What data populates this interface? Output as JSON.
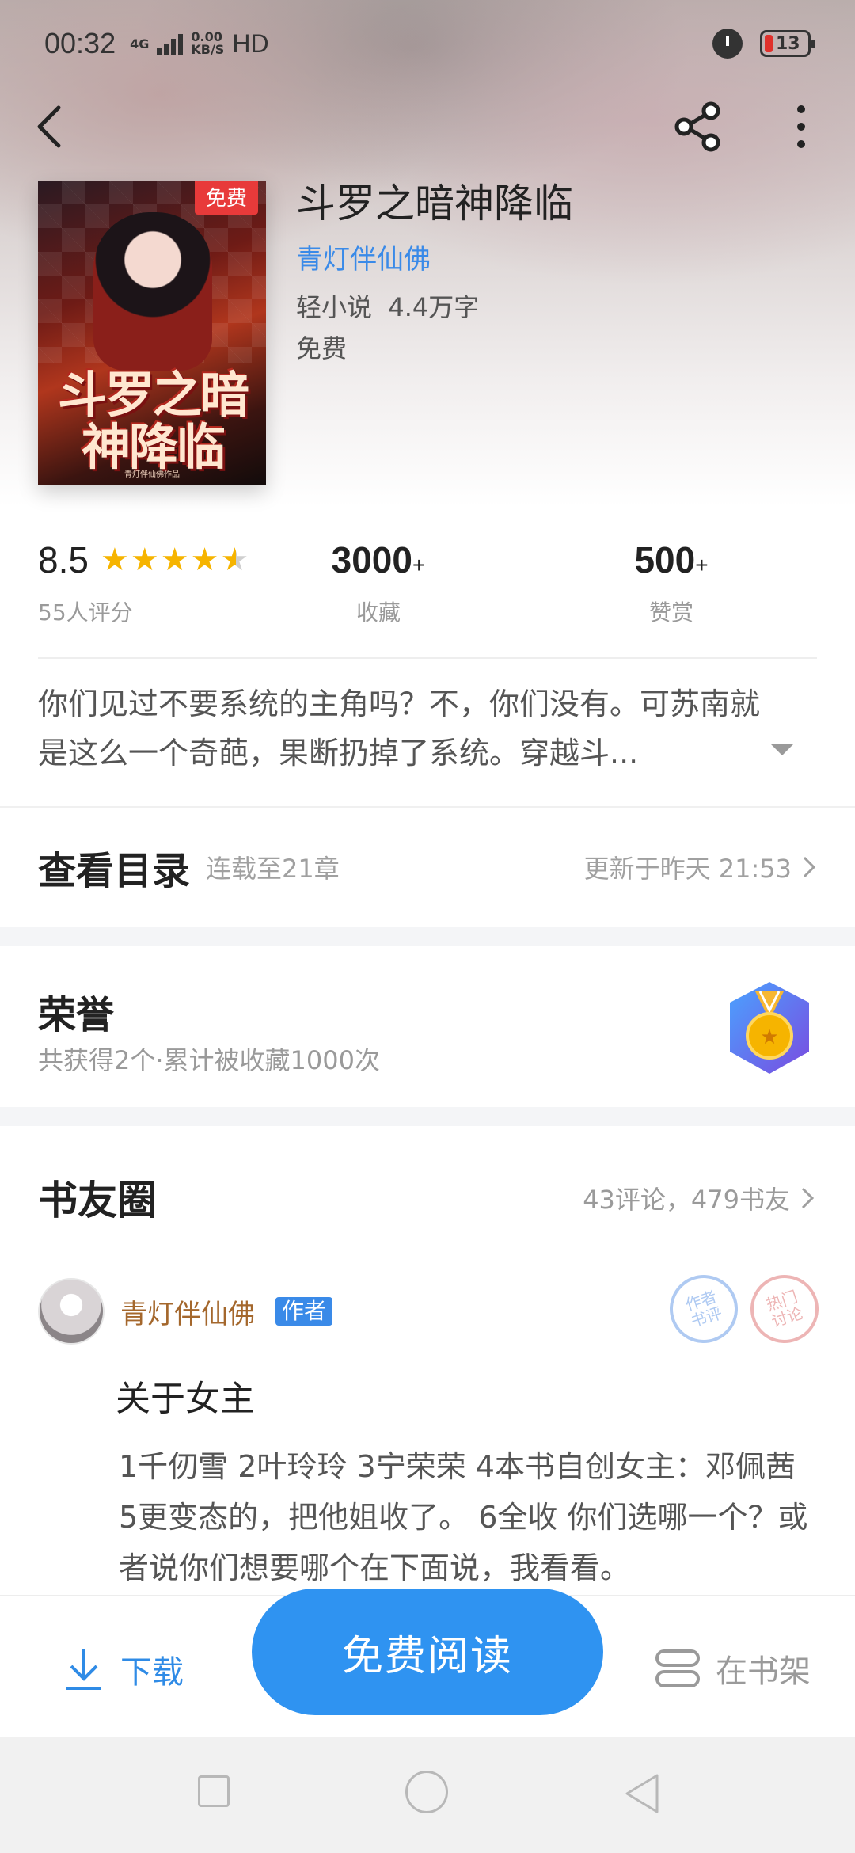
{
  "status_bar": {
    "time": "00:32",
    "network": "4G",
    "speed_value": "0.00",
    "speed_unit": "KB/S",
    "hd": "HD",
    "battery_level": "13"
  },
  "book": {
    "title": "斗罗之暗神降临",
    "author": "青灯伴仙佛",
    "category": "轻小说",
    "word_count": "4.4万字",
    "price": "免费",
    "free_badge": "免费",
    "cover_title": "斗罗之暗神降临",
    "cover_author": "青灯伴仙佛作品"
  },
  "stats": {
    "rating": "8.5",
    "stars": 4.5,
    "rating_count": "55人评分",
    "favorites": "3000",
    "favorites_suffix": "+",
    "favorites_label": "收藏",
    "rewards": "500",
    "rewards_suffix": "+",
    "rewards_label": "赞赏"
  },
  "summary": "你们见过不要系统的主角吗？不，你们没有。可苏南就是这么一个奇葩，果断扔掉了系统。穿越斗...",
  "toc": {
    "title": "查看目录",
    "progress": "连载至21章",
    "updated": "更新于昨天 21:53"
  },
  "honor": {
    "title": "荣誉",
    "subtitle": "共获得2个·累计被收藏1000次"
  },
  "circle": {
    "title": "书友圈",
    "stats": "43评论，479书友"
  },
  "post": {
    "author": "青灯伴仙佛",
    "author_tag": "作者",
    "stamp_author": "作者书评",
    "stamp_hot": "热门讨论",
    "title": "关于女主",
    "body": "1千仞雪 2叶玲玲 3宁荣荣 4本书自创女主：邓佩茜 5更变态的，把他姐收了。 6全收 你们选哪一个？或者说你们想要哪个在下面说，我看看。"
  },
  "bottom_bar": {
    "download_label": "下载",
    "read_label": "免费阅读",
    "shelf_label": "在书架"
  },
  "colors": {
    "accent": "#2f93f1",
    "author_link": "#3a8ae8",
    "star": "#f6b400",
    "free_badge": "#e83a3a"
  }
}
